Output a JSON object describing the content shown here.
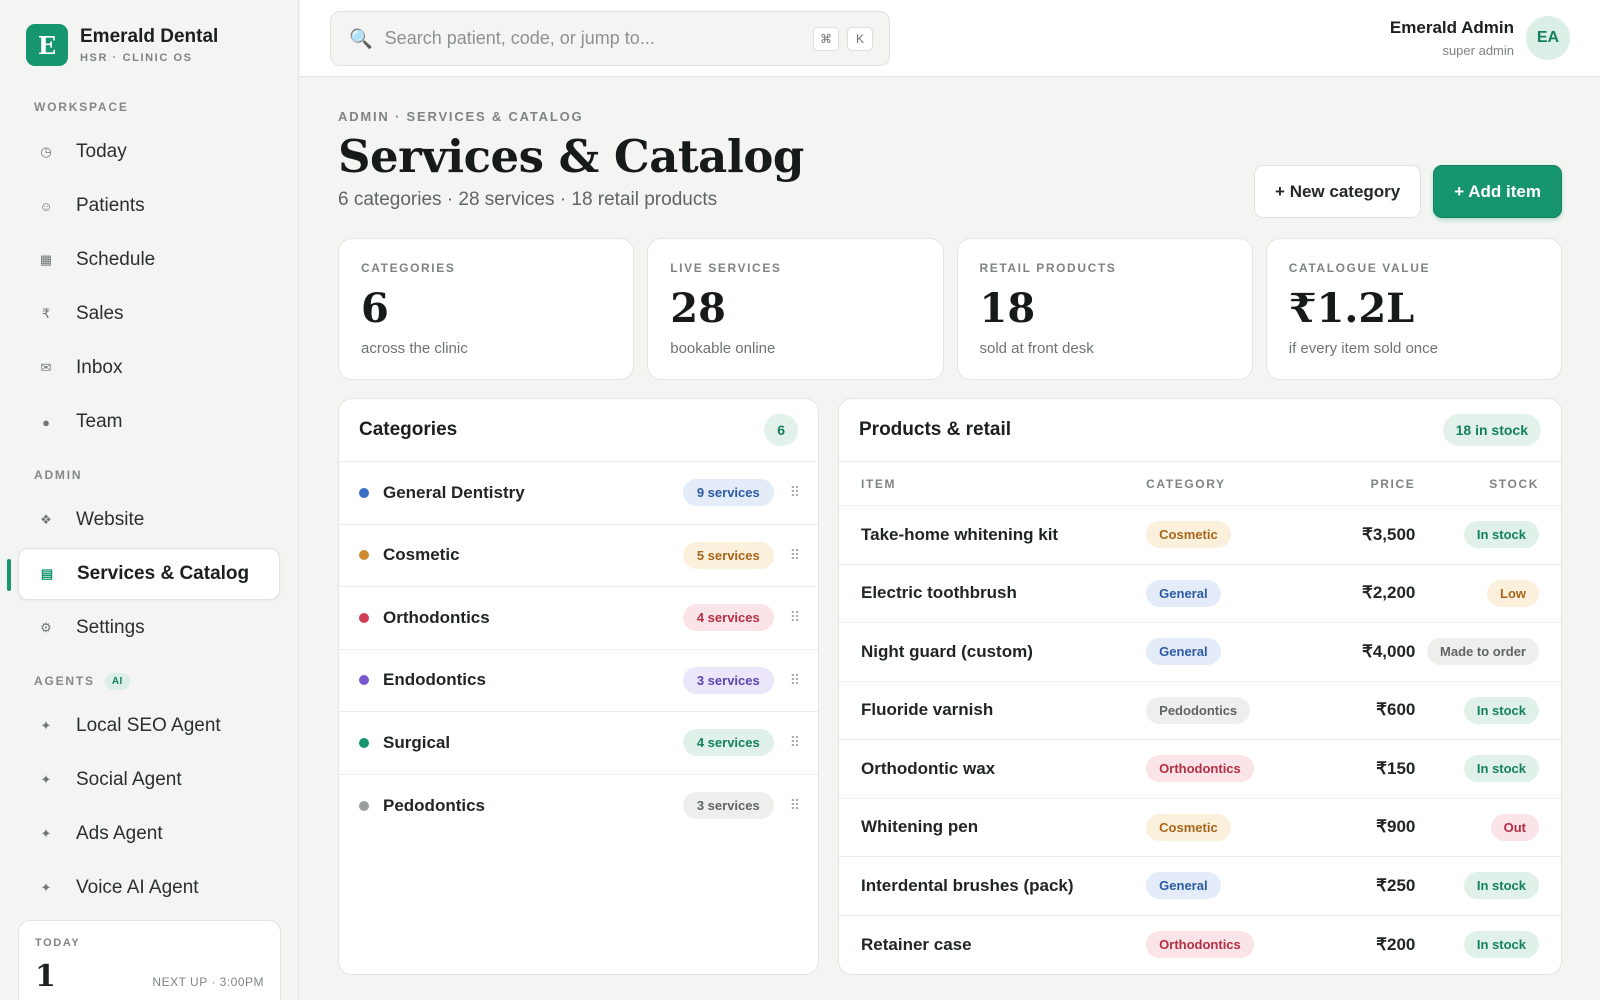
{
  "brand": {
    "logo_letter": "E",
    "name": "Emerald Dental",
    "sub": "HSR · CLINIC OS"
  },
  "sidebar": {
    "workspace_label": "WORKSPACE",
    "workspace_items": [
      {
        "icon": "clock-icon",
        "glyph": "◷",
        "label": "Today"
      },
      {
        "icon": "smiley-icon",
        "glyph": "☺",
        "label": "Patients"
      },
      {
        "icon": "calendar-icon",
        "glyph": "▦",
        "label": "Schedule"
      },
      {
        "icon": "rupee-icon",
        "glyph": "₹",
        "label": "Sales"
      },
      {
        "icon": "mail-icon",
        "glyph": "✉",
        "label": "Inbox"
      },
      {
        "icon": "team-icon",
        "glyph": "●",
        "label": "Team"
      }
    ],
    "admin_label": "ADMIN",
    "admin_items": [
      {
        "icon": "website-icon",
        "glyph": "❖",
        "label": "Website"
      },
      {
        "icon": "catalog-icon",
        "glyph": "▤",
        "label": "Services & Catalog",
        "active": true
      },
      {
        "icon": "gear-icon",
        "glyph": "⚙",
        "label": "Settings"
      }
    ],
    "agents_label": "AGENTS",
    "agents_badge": "AI",
    "agent_items": [
      {
        "icon": "sparkle-icon",
        "glyph": "✦",
        "label": "Local SEO Agent"
      },
      {
        "icon": "sparkle-icon",
        "glyph": "✦",
        "label": "Social Agent"
      },
      {
        "icon": "sparkle-icon",
        "glyph": "✦",
        "label": "Ads Agent"
      },
      {
        "icon": "sparkle-icon",
        "glyph": "✦",
        "label": "Voice AI Agent"
      }
    ],
    "today_card": {
      "label": "TODAY",
      "count": "1",
      "next": "NEXT UP · 3:00PM"
    }
  },
  "topbar": {
    "search_placeholder": "Search patient, code, or jump to...",
    "kbd1": "⌘",
    "kbd2": "K",
    "user_name": "Emerald Admin",
    "user_role": "super admin",
    "avatar": "EA"
  },
  "header": {
    "breadcrumb": "ADMIN · SERVICES & CATALOG",
    "title": "Services & Catalog",
    "subtitle": "6 categories · 28 services · 18 retail products",
    "new_category": "+ New category",
    "add_item": "+ Add item"
  },
  "stats": [
    {
      "label": "CATEGORIES",
      "value": "6",
      "sub": "across the clinic"
    },
    {
      "label": "LIVE SERVICES",
      "value": "28",
      "sub": "bookable online"
    },
    {
      "label": "RETAIL PRODUCTS",
      "value": "18",
      "sub": "sold at front desk"
    },
    {
      "label": "CATALOGUE VALUE",
      "value": "₹1.2L",
      "sub": "if every item sold once"
    }
  ],
  "categories": {
    "title": "Categories",
    "count": "6",
    "items": [
      {
        "name": "General Dentistry",
        "services": "9 services",
        "color": "#3a6fc4",
        "badge_bg": "#e3ecf8",
        "badge_fg": "#2c5aa3"
      },
      {
        "name": "Cosmetic",
        "services": "5 services",
        "color": "#d28a2e",
        "badge_bg": "#fbf0dc",
        "badge_fg": "#a8661c"
      },
      {
        "name": "Orthodontics",
        "services": "4 services",
        "color": "#d43d55",
        "badge_bg": "#fbe4e7",
        "badge_fg": "#b42f45"
      },
      {
        "name": "Endodontics",
        "services": "3 services",
        "color": "#7a58cf",
        "badge_bg": "#ece6fa",
        "badge_fg": "#5f42b1"
      },
      {
        "name": "Surgical",
        "services": "4 services",
        "color": "#16956f",
        "badge_bg": "#dff1e9",
        "badge_fg": "#15805f"
      },
      {
        "name": "Pedodontics",
        "services": "3 services",
        "color": "#9a9f9c",
        "badge_bg": "#eeefed",
        "badge_fg": "#5f6662"
      }
    ]
  },
  "products": {
    "title": "Products & retail",
    "count_label": "18 in stock",
    "columns": {
      "item": "ITEM",
      "category": "CATEGORY",
      "price": "PRICE",
      "stock": "STOCK"
    },
    "rows": [
      {
        "name": "Take-home whitening kit",
        "category": "Cosmetic",
        "cat_bg": "#fbf0dc",
        "cat_fg": "#a8661c",
        "price": "₹3,500",
        "stock": "In stock",
        "stock_bg": "#dff1e9",
        "stock_fg": "#15805f"
      },
      {
        "name": "Electric toothbrush",
        "category": "General",
        "cat_bg": "#e3ecf8",
        "cat_fg": "#2c5aa3",
        "price": "₹2,200",
        "stock": "Low",
        "stock_bg": "#fbf0dc",
        "stock_fg": "#a8661c"
      },
      {
        "name": "Night guard (custom)",
        "category": "General",
        "cat_bg": "#e3ecf8",
        "cat_fg": "#2c5aa3",
        "price": "₹4,000",
        "stock": "Made to order",
        "stock_bg": "#eeefed",
        "stock_fg": "#5f6662"
      },
      {
        "name": "Fluoride varnish",
        "category": "Pedodontics",
        "cat_bg": "#eeefed",
        "cat_fg": "#5f6662",
        "price": "₹600",
        "stock": "In stock",
        "stock_bg": "#dff1e9",
        "stock_fg": "#15805f"
      },
      {
        "name": "Orthodontic wax",
        "category": "Orthodontics",
        "cat_bg": "#fbe4e7",
        "cat_fg": "#b42f45",
        "price": "₹150",
        "stock": "In stock",
        "stock_bg": "#dff1e9",
        "stock_fg": "#15805f"
      },
      {
        "name": "Whitening pen",
        "category": "Cosmetic",
        "cat_bg": "#fbf0dc",
        "cat_fg": "#a8661c",
        "price": "₹900",
        "stock": "Out",
        "stock_bg": "#fbe4e7",
        "stock_fg": "#b42f45"
      },
      {
        "name": "Interdental brushes (pack)",
        "category": "General",
        "cat_bg": "#e3ecf8",
        "cat_fg": "#2c5aa3",
        "price": "₹250",
        "stock": "In stock",
        "stock_bg": "#dff1e9",
        "stock_fg": "#15805f"
      },
      {
        "name": "Retainer case",
        "category": "Orthodontics",
        "cat_bg": "#fbe4e7",
        "cat_fg": "#b42f45",
        "price": "₹200",
        "stock": "In stock",
        "stock_bg": "#dff1e9",
        "stock_fg": "#15805f"
      }
    ]
  }
}
